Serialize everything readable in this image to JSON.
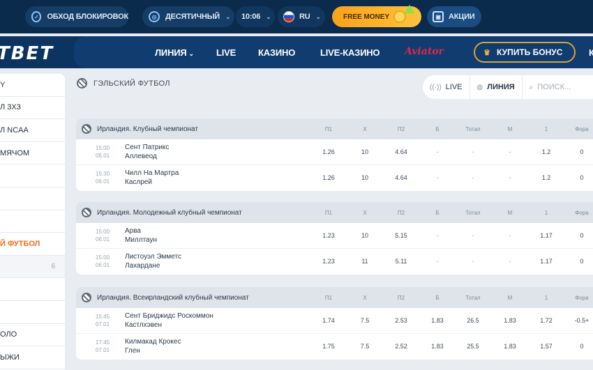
{
  "topbar": {
    "bypass_label": "ОБХОД БЛОКИРОВОК",
    "odds_format": "ДЕСЯТИЧНЫЙ",
    "time": "10:06",
    "language": "RU",
    "free_money_label": "FREE MONEY",
    "promo_label": "АКЦИИ"
  },
  "nav": {
    "logo": "TBET",
    "items": [
      "ЛИНИЯ",
      "LIVE",
      "КАЗИНО",
      "LIVE-КАЗИНО"
    ],
    "aviator": "Aviator",
    "bonus_label": "КУПИТЬ БОНУС",
    "more": "К"
  },
  "sidebar": {
    "items": [
      {
        "label": "Y",
        "count": ""
      },
      {
        "label": "Л 3Х3",
        "count": ""
      },
      {
        "label": "Л NCAA",
        "count": ""
      },
      {
        "label": "МЯЧОМ",
        "count": ""
      },
      {
        "label": "",
        "count": ""
      },
      {
        "label": "",
        "count": ""
      },
      {
        "label": "",
        "count": ""
      },
      {
        "label": "Й ФУТБОЛ",
        "count": ""
      },
      {
        "label": "",
        "count": "6"
      },
      {
        "label": "",
        "count": ""
      },
      {
        "label": "",
        "count": ""
      },
      {
        "label": "ОЛО",
        "count": ""
      },
      {
        "label": "ЫЖИ",
        "count": ""
      }
    ],
    "active_index": 7
  },
  "main": {
    "sport_title": "ГЭЛЬСКИЙ ФУТБОЛ",
    "filter_live": "LIVE",
    "filter_line": "ЛИНИЯ",
    "search_placeholder": "ПОИСК..."
  },
  "columns": [
    "П1",
    "X",
    "П2",
    "Б",
    "Тотал",
    "М",
    "1",
    "Фора"
  ],
  "leagues": [
    {
      "name": "Ирландия. Клубный чемпионат",
      "matches": [
        {
          "time": "15:00",
          "date": "06.01",
          "team1": "Сент Патрикс",
          "team2": "Аллевеод",
          "odds": [
            "1.26",
            "10",
            "4.64",
            "-",
            "-",
            "-",
            "1.2",
            "0"
          ]
        },
        {
          "time": "15:30",
          "date": "06.01",
          "team1": "Чилл На Мартра",
          "team2": "Каслрей",
          "odds": [
            "1.26",
            "10",
            "4.64",
            "-",
            "-",
            "-",
            "1.2",
            "0"
          ]
        }
      ]
    },
    {
      "name": "Ирландия. Молодежный клубный чемпионат",
      "matches": [
        {
          "time": "15:00",
          "date": "06.01",
          "team1": "Арва",
          "team2": "Миллтаун",
          "odds": [
            "1.23",
            "10",
            "5.15",
            "-",
            "-",
            "-",
            "1.17",
            "0"
          ]
        },
        {
          "time": "15:00",
          "date": "06.01",
          "team1": "Листоуэл Эмметс",
          "team2": "Лахардане",
          "odds": [
            "1.23",
            "11",
            "5.11",
            "-",
            "-",
            "-",
            "1.17",
            "0"
          ]
        }
      ]
    },
    {
      "name": "Ирландия. Всеирландский клубный чемпионат",
      "matches": [
        {
          "time": "15:45",
          "date": "07.01",
          "team1": "Сент Бриджидс Роскоммон",
          "team2": "Кастлхэвен",
          "odds": [
            "1.74",
            "7.5",
            "2.53",
            "1.83",
            "26.5",
            "1.83",
            "1.72",
            "-0.5+"
          ]
        },
        {
          "time": "17:45",
          "date": "07.01",
          "team1": "Килмакад Крокес",
          "team2": "Глен",
          "odds": [
            "1.75",
            "7.5",
            "2.52",
            "1.83",
            "25.5",
            "1.83",
            "1.57",
            "0"
          ]
        }
      ]
    }
  ]
}
